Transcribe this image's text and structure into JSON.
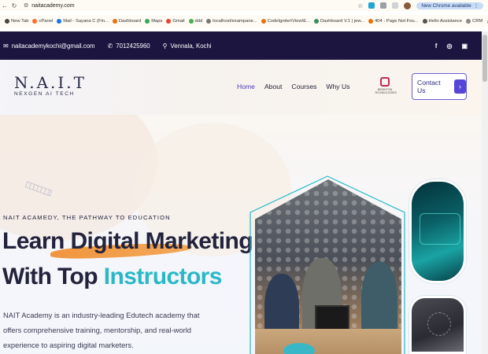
{
  "browser": {
    "url": "naitacademy.com",
    "update_label": "New Chrome available",
    "bookmarks": [
      {
        "label": "New Tab",
        "color": "#444444"
      },
      {
        "label": "cPanel",
        "color": "#ff6c2c"
      },
      {
        "label": "Mail - Sayana C (Fin...",
        "color": "#1a73e8"
      },
      {
        "label": "Dashboard",
        "color": "#e8710a"
      },
      {
        "label": "Maps",
        "color": "#34a853"
      },
      {
        "label": "Gmail",
        "color": "#ea4335"
      },
      {
        "label": "ddd",
        "color": "#4caf50"
      },
      {
        "label": "localhost/exampane...",
        "color": "#777777"
      },
      {
        "label": "CodeIgniter\\View\\E...",
        "color": "#e8710a"
      },
      {
        "label": "Dashboard V.1 | jew...",
        "color": "#3c8d5b"
      },
      {
        "label": "404 - Page Not Fou...",
        "color": "#e8710a"
      },
      {
        "label": "Hello Assistance",
        "color": "#555555"
      },
      {
        "label": "CRM",
        "color": "#888888"
      }
    ]
  },
  "topbar": {
    "email": "naitacademykochi@gmail.com",
    "phone": "7012425960",
    "location": "Vennala, Kochi",
    "social": [
      "facebook-icon",
      "whatsapp-icon",
      "instagram-icon"
    ]
  },
  "header": {
    "logo_mark": "N.A.I.T",
    "logo_sub": "NEXGEN AI TECH",
    "nav": [
      "Home",
      "About",
      "Courses",
      "Why Us"
    ],
    "badge_text": "BRIGHTON TECHNOLOGIES",
    "contact_label": "Contact Us"
  },
  "hero": {
    "tagline": "NAIT ACAMEDY, THE PATHWAY TO EDUCATION",
    "line1_a": "Learn ",
    "line1_b": "Digital Marketing",
    "line2_a": "With Top ",
    "line2_b": "Instructors",
    "description": "NAIT Academy is an industry-leading Edutech academy that offers comprehensive training, mentorship, and real-world experience to aspiring digital marketers."
  },
  "colors": {
    "topbar_bg": "#1c1540",
    "accent_purple": "#5546d8",
    "accent_teal": "#2ab8c8",
    "brush_orange": "#f08a2a"
  }
}
